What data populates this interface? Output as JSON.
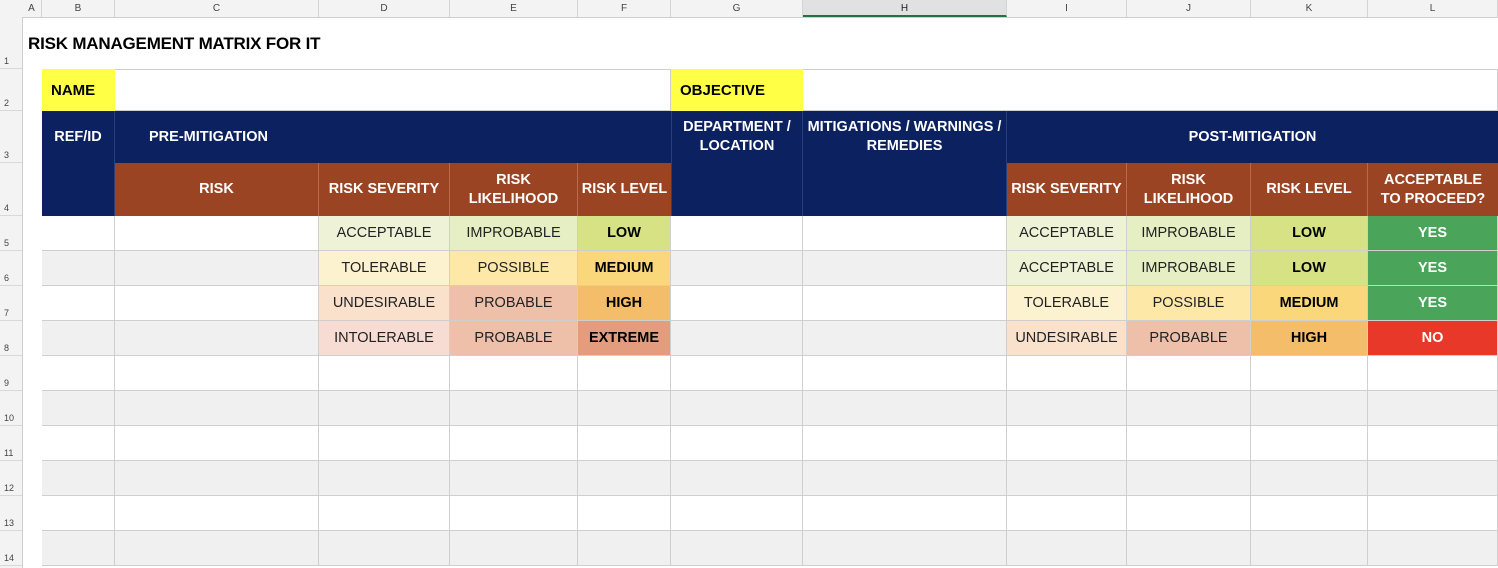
{
  "columns": [
    "A",
    "B",
    "C",
    "D",
    "E",
    "F",
    "G",
    "H",
    "I",
    "J",
    "K",
    "L"
  ],
  "selected_column": "H",
  "rows": [
    "1",
    "2",
    "3",
    "4",
    "5",
    "6",
    "7",
    "8",
    "9",
    "10",
    "11",
    "12",
    "13",
    "14"
  ],
  "title": "RISK MANAGEMENT MATRIX FOR IT",
  "labels": {
    "name": "NAME",
    "objective": "OBJECTIVE",
    "ref_id": "REF/ID",
    "pre_mitigation": "PRE-MITIGATION",
    "department_location": "DEPARTMENT / LOCATION",
    "mitigations": "MITIGATIONS / WARNINGS / REMEDIES",
    "post_mitigation": "POST-MITIGATION",
    "risk": "RISK",
    "risk_severity": "RISK SEVERITY",
    "risk_likelihood": "RISK LIKELIHOOD",
    "risk_level": "RISK LEVEL",
    "acceptable_to_proceed": "ACCEPTABLE TO PROCEED?"
  },
  "data_rows": [
    {
      "pre_severity": "ACCEPTABLE",
      "pre_likelihood": "IMPROBABLE",
      "pre_level": "LOW",
      "post_severity": "ACCEPTABLE",
      "post_likelihood": "IMPROBABLE",
      "post_level": "LOW",
      "proceed": "YES"
    },
    {
      "pre_severity": "TOLERABLE",
      "pre_likelihood": "POSSIBLE",
      "pre_level": "MEDIUM",
      "post_severity": "ACCEPTABLE",
      "post_likelihood": "IMPROBABLE",
      "post_level": "LOW",
      "proceed": "YES"
    },
    {
      "pre_severity": "UNDESIRABLE",
      "pre_likelihood": "PROBABLE",
      "pre_level": "HIGH",
      "post_severity": "TOLERABLE",
      "post_likelihood": "POSSIBLE",
      "post_level": "MEDIUM",
      "proceed": "YES"
    },
    {
      "pre_severity": "INTOLERABLE",
      "pre_likelihood": "PROBABLE",
      "pre_level": "EXTREME",
      "post_severity": "UNDESIRABLE",
      "post_likelihood": "PROBABLE",
      "post_level": "HIGH",
      "proceed": "NO"
    }
  ],
  "colors": {
    "header_navy": "#0b2160",
    "header_brown": "#9a4424",
    "label_yellow": "#ffff45",
    "severity": {
      "ACCEPTABLE": "#eef3d7",
      "TOLERABLE": "#fdf2d0",
      "UNDESIRABLE": "#f9e1cc",
      "INTOLERABLE": "#f6dcd2"
    },
    "likelihood": {
      "IMPROBABLE": "#e6efc4",
      "POSSIBLE": "#fde8a8",
      "PROBABLE": "#eebfa9"
    },
    "level": {
      "LOW": "#d6e283",
      "MEDIUM": "#fad77a",
      "HIGH": "#f3bd6a",
      "EXTREME": "#e39d7e"
    },
    "proceed": {
      "YES": "#4aa55a",
      "NO": "#e8382a"
    }
  }
}
